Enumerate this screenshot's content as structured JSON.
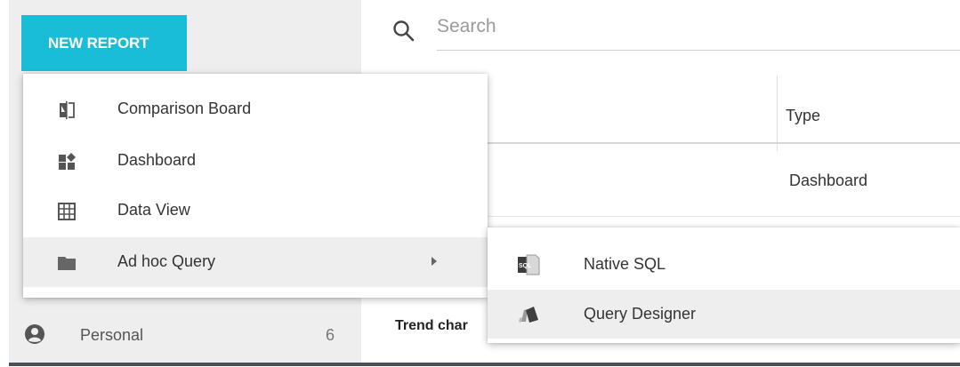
{
  "toolbar": {
    "new_report_label": "NEW REPORT"
  },
  "search": {
    "placeholder": "Search",
    "value": ""
  },
  "table": {
    "columns": [
      "Type"
    ],
    "rows": [
      {
        "type": "Dashboard"
      },
      {
        "name": "Trend char"
      }
    ]
  },
  "sidebar": {
    "personal": {
      "label": "Personal",
      "count": "6",
      "icon": "account-circle-icon"
    }
  },
  "menu": {
    "items": [
      {
        "label": "Comparison Board",
        "icon": "compare-icon"
      },
      {
        "label": "Dashboard",
        "icon": "dashboard-icon"
      },
      {
        "label": "Data View",
        "icon": "grid-icon"
      },
      {
        "label": "Ad hoc Query",
        "icon": "folder-icon",
        "has_submenu": true
      }
    ]
  },
  "submenu": {
    "items": [
      {
        "label": "Native SQL",
        "icon": "sql-file-icon"
      },
      {
        "label": "Query Designer",
        "icon": "query-designer-icon"
      }
    ]
  },
  "colors": {
    "accent": "#19bdd7",
    "sidebar_bg": "#eeeeee",
    "hover_bg": "#eeeeee"
  }
}
